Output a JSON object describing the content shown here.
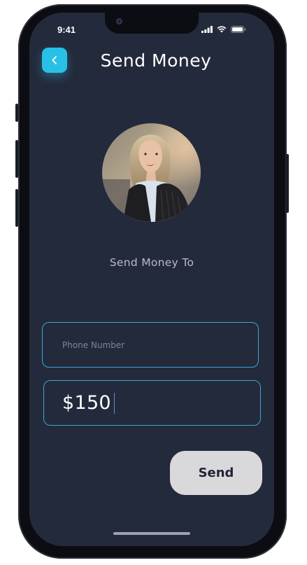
{
  "status_bar": {
    "time": "9:41"
  },
  "header": {
    "title": "Send Money",
    "back_icon": "chevron-left-icon"
  },
  "recipient": {
    "avatar": "profile-photo",
    "label": "Send Money To"
  },
  "form": {
    "phone_placeholder": "Phone Number",
    "phone_value": "",
    "amount_value": "$150"
  },
  "actions": {
    "send_label": "Send"
  },
  "colors": {
    "background": "#232a3b",
    "accent": "#29c0e8",
    "field_border": "#3aa6dc",
    "send_button": "#d9d9dc"
  }
}
